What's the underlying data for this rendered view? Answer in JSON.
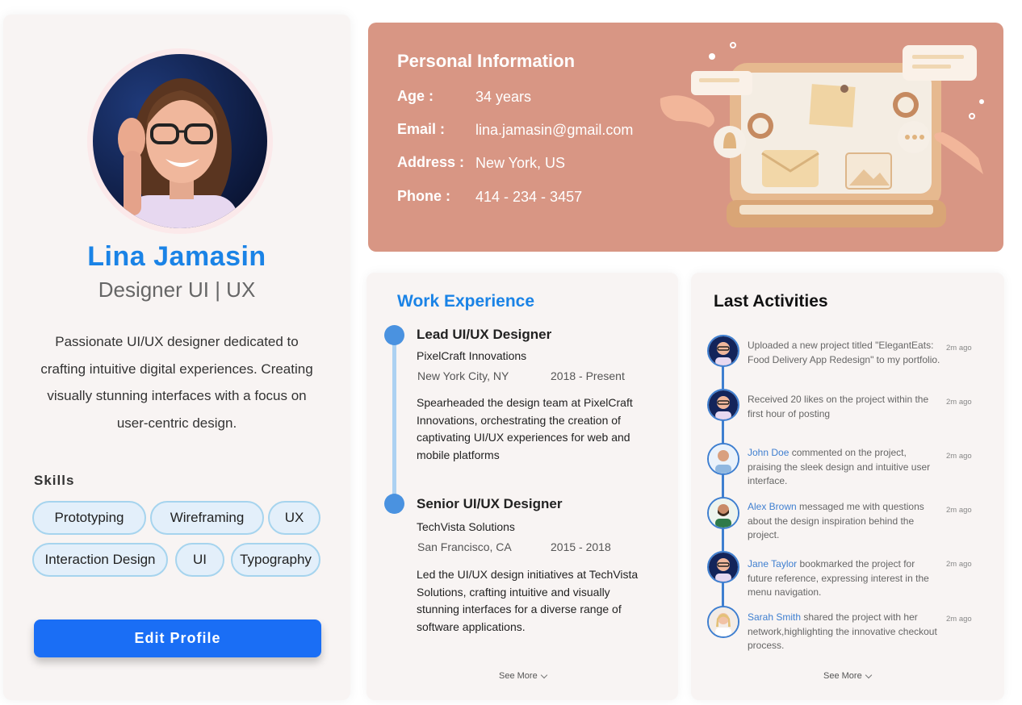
{
  "profile": {
    "name": "Lina Jamasin",
    "role": "Designer UI | UX",
    "bio": "Passionate UI/UX designer dedicated to crafting intuitive digital experiences. Creating visually stunning interfaces with a focus on user-centric design.",
    "skills_title": "Skills",
    "skills": [
      "Prototyping",
      "Wireframing",
      "UX",
      "Interaction Design",
      "UI",
      "Typography"
    ],
    "edit_button": "Edit Profile"
  },
  "personal_info": {
    "title": "Personal Information",
    "fields": [
      {
        "label": "Age :",
        "value": "34 years"
      },
      {
        "label": "Email :",
        "value": "lina.jamasin@gmail.com"
      },
      {
        "label": "Address :",
        "value": "New York, US"
      },
      {
        "label": "Phone :",
        "value": "414 - 234 - 3457"
      }
    ]
  },
  "work_experience": {
    "title": "Work Experience",
    "jobs": [
      {
        "title": "Lead UI/UX Designer",
        "company": "PixelCraft Innovations",
        "location": "New York City, NY",
        "dates": "2018 - Present",
        "description": "Spearheaded the design team at PixelCraft Innovations, orchestrating the creation of captivating UI/UX experiences for web and mobile platforms"
      },
      {
        "title": "Senior UI/UX Designer",
        "company": "TechVista Solutions",
        "location": "San Francisco, CA",
        "dates": "2015 - 2018",
        "description": "Led the UI/UX design initiatives at TechVista Solutions, crafting intuitive and visually stunning interfaces for a diverse range of software applications."
      }
    ],
    "see_more": "See More"
  },
  "activities": {
    "title": "Last Activities",
    "items": [
      {
        "actor": "",
        "text": "Uploaded a new project titled \"ElegantEats: Food Delivery App Redesign\" to my portfolio.",
        "time": "2m ago"
      },
      {
        "actor": "",
        "text": "Received 20 likes on the project within the first hour of posting",
        "time": "2m ago"
      },
      {
        "actor": "John Doe",
        "text": " commented on the project, praising the sleek design and intuitive user interface.",
        "time": "2m ago"
      },
      {
        "actor": "Alex Brown",
        "text": " messaged me with questions about the design inspiration behind the project.",
        "time": "2m ago"
      },
      {
        "actor": "Jane Taylor",
        "text": " bookmarked the project for future reference, expressing interest in the menu navigation.",
        "time": "2m ago"
      },
      {
        "actor": "Sarah Smith",
        "text": " shared the project with her network,highlighting the innovative checkout process.",
        "time": "2m ago"
      }
    ],
    "see_more": "See More"
  },
  "colors": {
    "accent_blue": "#1a83e6",
    "button_blue": "#1a6ef5",
    "banner": "#d89684",
    "chip_fill": "#e3effa",
    "chip_border": "#a6d4ee",
    "card_bg": "#f8f4f3"
  },
  "icons": [
    "avatar-photo",
    "laptop-illustration",
    "chevron-down-icon",
    "timeline-dot"
  ]
}
